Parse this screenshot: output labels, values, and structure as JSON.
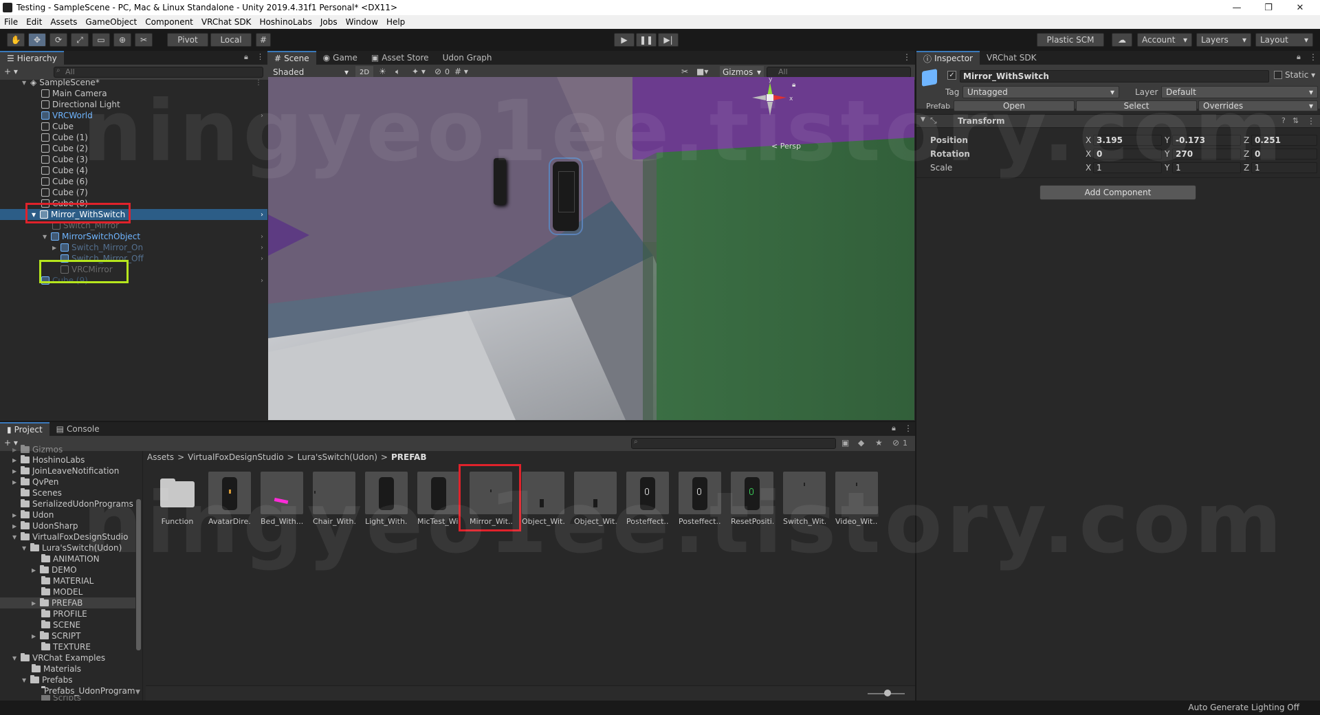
{
  "window": {
    "title": "Testing - SampleScene - PC, Mac & Linux Standalone - Unity 2019.4.31f1 Personal* <DX11>",
    "min": "—",
    "max": "❐",
    "close": "✕"
  },
  "menu": [
    "File",
    "Edit",
    "Assets",
    "GameObject",
    "Component",
    "VRChat SDK",
    "HoshinoLabs",
    "Jobs",
    "Window",
    "Help"
  ],
  "toolbar": {
    "pivot": "Pivot",
    "local": "Local",
    "plastic": "Plastic SCM",
    "account": "Account",
    "layers": "Layers",
    "layout": "Layout"
  },
  "hierarchy": {
    "tab": "Hierarchy",
    "search_placeholder": "All",
    "scene": "SampleScene*",
    "rows": [
      "Main Camera",
      "Directional Light",
      "VRCWorld",
      "Cube",
      "Cube (1)",
      "Cube (2)",
      "Cube (3)",
      "Cube (4)",
      "Cube (6)",
      "Cube (7)",
      "Cube (8)",
      "Mirror_WithSwitch",
      "Switch_Mirror",
      "MirrorSwitchObject",
      "Switch_Mirror_On",
      "Switch_Mirror_Off",
      "VRCMirror",
      "Cube (9)"
    ]
  },
  "scene": {
    "tabs": [
      "Scene",
      "Game",
      "Asset Store",
      "Udon Graph"
    ],
    "shading": "Shaded",
    "mode2d": "2D",
    "hidden_count": "0",
    "gizmos": "Gizmos",
    "search_placeholder": "All",
    "persp": "Persp",
    "axis_x": "x",
    "axis_y": "y"
  },
  "inspector": {
    "tabs": [
      "Inspector",
      "VRChat SDK"
    ],
    "object_name": "Mirror_WithSwitch",
    "static_label": "Static",
    "tag_label": "Tag",
    "tag_value": "Untagged",
    "layer_label": "Layer",
    "layer_value": "Default",
    "prefab_label": "Prefab",
    "open": "Open",
    "select": "Select",
    "overrides": "Overrides",
    "transform": "Transform",
    "position_label": "Position",
    "rotation_label": "Rotation",
    "scale_label": "Scale",
    "axis": {
      "x": "X",
      "y": "Y",
      "z": "Z"
    },
    "position": {
      "x": "3.195",
      "y": "-0.173",
      "z": "0.251"
    },
    "rotation": {
      "x": "0",
      "y": "270",
      "z": "0"
    },
    "scale": {
      "x": "1",
      "y": "1",
      "z": "1"
    },
    "add_component": "Add Component"
  },
  "project": {
    "tabs": [
      "Project",
      "Console"
    ],
    "hidden_count": "1",
    "tree": [
      "Gizmos",
      "HoshinoLabs",
      "JoinLeaveNotification",
      "QvPen",
      "Scenes",
      "SerializedUdonPrograms",
      "Udon",
      "UdonSharp",
      "VirtualFoxDesignStudio",
      "Lura'sSwitch(Udon)",
      "ANIMATION",
      "DEMO",
      "MATERIAL",
      "MODEL",
      "PREFAB",
      "PROFILE",
      "SCENE",
      "SCRIPT",
      "TEXTURE",
      "VRChat Examples",
      "Materials",
      "Prefabs",
      "Prefabs_UdonProgram",
      "Scripts"
    ],
    "breadcrumb": [
      "Assets",
      "VirtualFoxDesignStudio",
      "Lura'sSwitch(Udon)",
      "PREFAB"
    ],
    "assets": [
      "Function",
      "AvatarDire...",
      "Bed_With...",
      "Chair_With...",
      "Light_With...",
      "MicTest_Wi...",
      "Mirror_Wit...",
      "Object_Wit...",
      "Object_Wit...",
      "Posteffect...",
      "Posteffect...",
      "ResetPositi...",
      "Switch_Wit...",
      "Video_Wit..."
    ]
  },
  "status": {
    "lighting": "Auto Generate Lighting Off"
  },
  "watermark": "ningyeo1ee.tistory.com",
  "colors": {
    "selection": "#2c5d87",
    "highlight_red": "#e0222b",
    "highlight_green": "#b6e61d",
    "prefab_blue": "#6fb5ff",
    "wall_purple": "#6b3b8e",
    "wall_green": "#3a6d41"
  }
}
